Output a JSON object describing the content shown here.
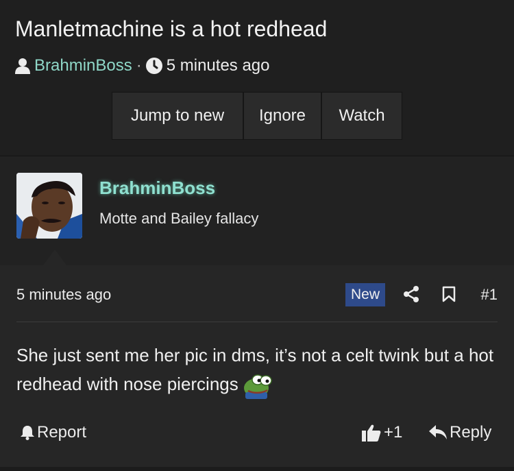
{
  "thread": {
    "title": "Manletmachine is a hot redhead",
    "author": "BrahminBoss",
    "separator": "·",
    "time": "5 minutes ago",
    "buttons": {
      "jump": "Jump to new",
      "ignore": "Ignore",
      "watch": "Watch"
    }
  },
  "post": {
    "username": "BrahminBoss",
    "user_title": "Motte and Bailey fallacy",
    "time": "5 minutes ago",
    "badge": "New",
    "number": "#1",
    "body": "She just sent me her pic in dms, it’s not a celt twink but a hot redhead with nose piercings",
    "emoji_icon": "pepe-emoji",
    "actions": {
      "report": "Report",
      "like_count": "+1",
      "reply": "Reply"
    }
  },
  "colors": {
    "background": "#1f1f1f",
    "username": "#8fe0d0",
    "author_link": "#8fd8c8",
    "badge_new": "#2e4a8a"
  }
}
